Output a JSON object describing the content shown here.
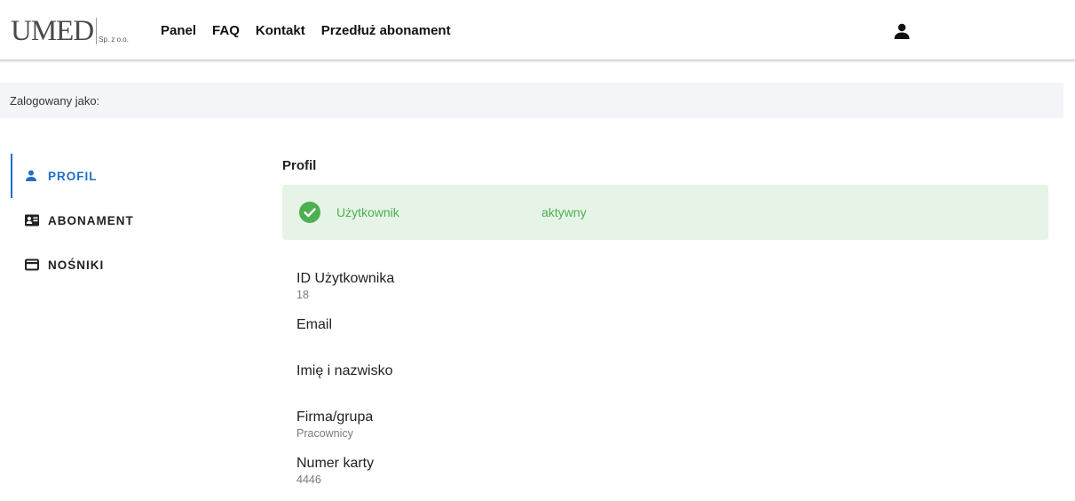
{
  "header": {
    "logo_main": "UMED",
    "logo_sub": "Sp. z o.o.",
    "nav": [
      "Panel",
      "FAQ",
      "Kontakt",
      "Przedłuż abonament"
    ]
  },
  "logged_in": {
    "label": "Zalogowany jako:"
  },
  "sidebar": {
    "items": [
      {
        "label": "PROFIL",
        "icon": "person-icon",
        "active": true
      },
      {
        "label": "ABONAMENT",
        "icon": "id-card-icon",
        "active": false
      },
      {
        "label": "NOŚNIKI",
        "icon": "card-icon",
        "active": false
      }
    ]
  },
  "main": {
    "title": "Profil",
    "alert": {
      "label": "Użytkownik",
      "value": "aktywny",
      "color": "#4caf50",
      "background": "#e6f4e7"
    },
    "fields": [
      {
        "label": "ID Użytkownika",
        "value": "18"
      },
      {
        "label": "Email",
        "value": ""
      },
      {
        "label": "Imię i nazwisko",
        "value": ""
      },
      {
        "label": "Firma/grupa",
        "value": "Pracownicy"
      },
      {
        "label": "Numer karty",
        "value": "4446"
      }
    ]
  },
  "colors": {
    "accent": "#1e6fc4",
    "success": "#4caf50"
  }
}
